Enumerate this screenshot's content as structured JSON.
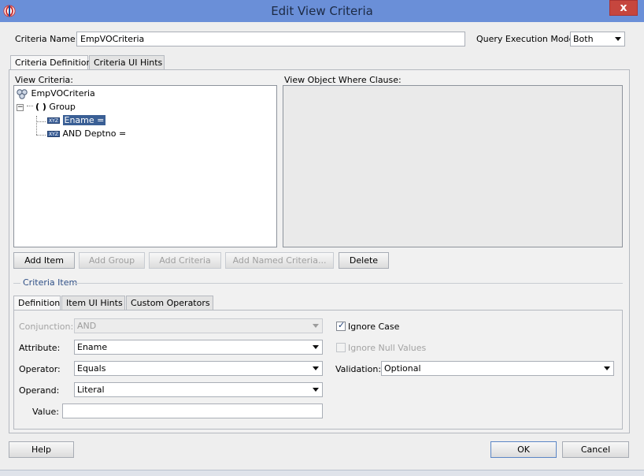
{
  "window": {
    "title": "Edit View Criteria",
    "close_glyph": "x"
  },
  "header": {
    "criteria_name_label": "Criteria Name:",
    "criteria_name_value": "EmpVOCriteria",
    "query_mode_label": "Query Execution Mode:",
    "query_mode_value": "Both"
  },
  "main_tabs": [
    {
      "label": "Criteria Definition",
      "active": true
    },
    {
      "label": "Criteria UI Hints",
      "active": false
    }
  ],
  "view_criteria": {
    "label": "View Criteria:",
    "tree": {
      "root": "EmpVOCriteria",
      "group": "Group",
      "group_glyph": "( )",
      "items": [
        {
          "label": "Ename =",
          "badge": "XYZ",
          "selected": true
        },
        {
          "label": "AND Deptno =",
          "badge": "XYZ",
          "selected": false
        }
      ]
    }
  },
  "where_clause": {
    "label": "View Object Where Clause:"
  },
  "tree_buttons": {
    "add_item": "Add Item",
    "add_group": "Add Group",
    "add_criteria": "Add Criteria",
    "add_named_criteria": "Add Named Criteria...",
    "delete": "Delete"
  },
  "criteria_item": {
    "section_label": "Criteria Item",
    "tabs": [
      {
        "label": "Definition",
        "active": true
      },
      {
        "label": "Item UI Hints",
        "active": false
      },
      {
        "label": "Custom Operators",
        "active": false
      }
    ],
    "conjunction_label": "Conjunction:",
    "conjunction_value": "AND",
    "attribute_label": "Attribute:",
    "attribute_value": "Ename",
    "operator_label": "Operator:",
    "operator_value": "Equals",
    "operand_label": "Operand:",
    "operand_value": "Literal",
    "value_label": "Value:",
    "value_value": "",
    "ignore_case_label": "Ignore Case",
    "ignore_case_checked": true,
    "ignore_null_label": "Ignore Null Values",
    "ignore_null_checked": false,
    "validation_label": "Validation:",
    "validation_value": "Optional"
  },
  "footer": {
    "help": "Help",
    "ok": "OK",
    "cancel": "Cancel"
  },
  "icons": {
    "app": "oracle-jdeveloper-icon",
    "root": "view-criteria-root-icon",
    "badge": "attribute-xyz-icon"
  },
  "colors": {
    "titlebar": "#6a8fd8",
    "close": "#c6463e",
    "selection": "#3a5f95",
    "dialog": "#eeeeee"
  }
}
